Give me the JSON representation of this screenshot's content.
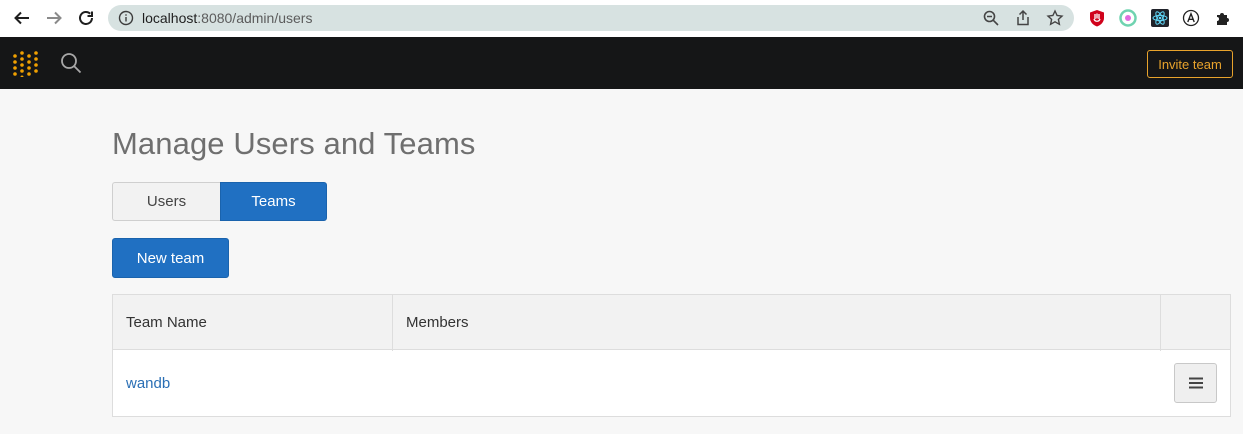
{
  "browser": {
    "url_host": "localhost",
    "url_rest": ":8080/admin/users"
  },
  "navbar": {
    "invite_label": "Invite team"
  },
  "page": {
    "title": "Manage Users and Teams"
  },
  "tabs": [
    {
      "label": "Users",
      "active": false
    },
    {
      "label": "Teams",
      "active": true
    }
  ],
  "actions": {
    "new_team_label": "New team"
  },
  "table": {
    "columns": [
      "Team Name",
      "Members",
      ""
    ],
    "rows": [
      {
        "team_name": "wandb",
        "members": ""
      }
    ]
  },
  "colors": {
    "accent": "#2070c2",
    "navbar_bg": "#151617",
    "invite_border": "#e8a32c"
  }
}
